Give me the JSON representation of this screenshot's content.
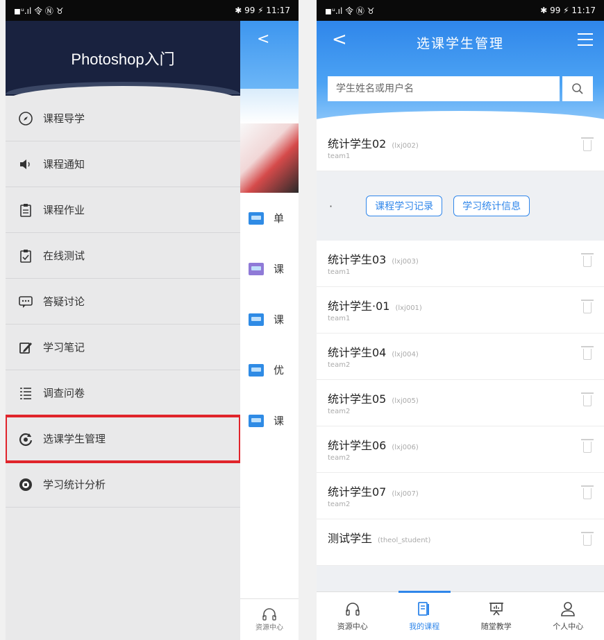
{
  "left_screen": {
    "status": {
      "left": "◼ᵘ.ıl 令 Ⓝ ♉",
      "right": "✱ 99 ⚡ 11:17"
    },
    "drawer_title": "Photoshop入门",
    "menu_items": [
      {
        "label": "课程导学",
        "icon": "compass-icon"
      },
      {
        "label": "课程通知",
        "icon": "speaker-icon"
      },
      {
        "label": "课程作业",
        "icon": "clipboard-icon"
      },
      {
        "label": "在线测试",
        "icon": "checklist-icon"
      },
      {
        "label": "答疑讨论",
        "icon": "chat-icon"
      },
      {
        "label": "学习笔记",
        "icon": "pen-note-icon"
      },
      {
        "label": "调查问卷",
        "icon": "list-icon"
      },
      {
        "label": "选课学生管理",
        "icon": "refresh-user-icon",
        "highlighted": true
      },
      {
        "label": "学习统计分析",
        "icon": "chart-circle-icon"
      }
    ],
    "peek_back": "<",
    "peek_items": [
      "单",
      "课",
      "课",
      "优",
      "课"
    ],
    "peek_bottom_tab": "资源中心"
  },
  "right_screen": {
    "status": {
      "left": "◼ᵘ.ıl 令 Ⓝ ♉",
      "right": "✱ 99 ⚡ 11:17"
    },
    "title": "选课学生管理",
    "back": "<",
    "search": {
      "placeholder": "学生姓名或用户名"
    },
    "students": [
      {
        "name": "统计学生02",
        "id": "(lxj002)",
        "team": "team1"
      },
      {
        "name": "统计学生03",
        "id": "(lxj003)",
        "team": "team1"
      },
      {
        "name": "统计学生·01",
        "id": "(lxj001)",
        "team": "team1"
      },
      {
        "name": "统计学生04",
        "id": "(lxj004)",
        "team": "team2"
      },
      {
        "name": "统计学生05",
        "id": "(lxj005)",
        "team": "team2"
      },
      {
        "name": "统计学生06",
        "id": "(lxj006)",
        "team": "team2"
      },
      {
        "name": "统计学生07",
        "id": "(lxj007)",
        "team": "team2"
      },
      {
        "name": "测试学生",
        "id": "(theol_student)",
        "team": ""
      }
    ],
    "expand_actions": {
      "dot": "·",
      "record": "课程学习记录",
      "stats": "学习统计信息"
    },
    "tabs": [
      {
        "label": "资源中心",
        "icon": "headphones-icon"
      },
      {
        "label": "我的课程",
        "icon": "book-icon",
        "active": true
      },
      {
        "label": "随堂教学",
        "icon": "board-icon"
      },
      {
        "label": "个人中心",
        "icon": "user-icon"
      }
    ],
    "accent": "#2f86ea"
  }
}
